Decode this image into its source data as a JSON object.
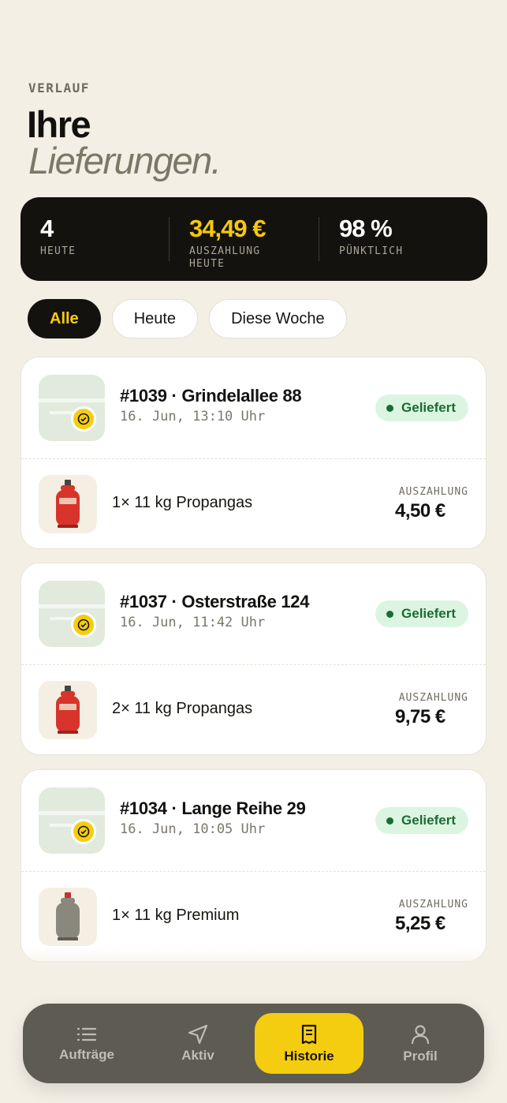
{
  "header": {
    "eyebrow": "VERLAUF",
    "title_line1": "Ihre",
    "title_line2": "Lieferungen."
  },
  "stats": [
    {
      "value": "4",
      "label": "HEUTE"
    },
    {
      "value": "34,49 €",
      "label": "AUSZAHLUNG HEUTE"
    },
    {
      "value": "98 %",
      "label": "PÜNKTLICH"
    }
  ],
  "filters": [
    {
      "label": "Alle",
      "active": true
    },
    {
      "label": "Heute",
      "active": false
    },
    {
      "label": "Diese Woche",
      "active": false
    }
  ],
  "orders": [
    {
      "title": "#1039 · Grindelallee 88",
      "time": "16. Jun, 13:10 Uhr",
      "status": "Geliefert",
      "product": "1× 11 kg Propangas",
      "payout_label": "AUSZAHLUNG",
      "payout": "4,50 €",
      "cylinder_color": "#d8342b"
    },
    {
      "title": "#1037 · Osterstraße 124",
      "time": "16. Jun, 11:42 Uhr",
      "status": "Geliefert",
      "product": "2× 11 kg Propangas",
      "payout_label": "AUSZAHLUNG",
      "payout": "9,75 €",
      "cylinder_color": "#d8342b"
    },
    {
      "title": "#1034 · Lange Reihe 29",
      "time": "16. Jun, 10:05 Uhr",
      "status": "Geliefert",
      "product": "1× 11 kg Premium",
      "payout_label": "AUSZAHLUNG",
      "payout": "5,25 €",
      "cylinder_color": "#8a877c"
    }
  ],
  "nav": [
    {
      "label": "Aufträge",
      "icon": "list-icon"
    },
    {
      "label": "Aktiv",
      "icon": "navigation-icon"
    },
    {
      "label": "Historie",
      "icon": "receipt-icon",
      "active": true
    },
    {
      "label": "Profil",
      "icon": "user-icon"
    }
  ],
  "colors": {
    "accent": "#f5cd10",
    "dark": "#14120f",
    "success": "#1b6b35",
    "success_bg": "#dcf5e1"
  }
}
